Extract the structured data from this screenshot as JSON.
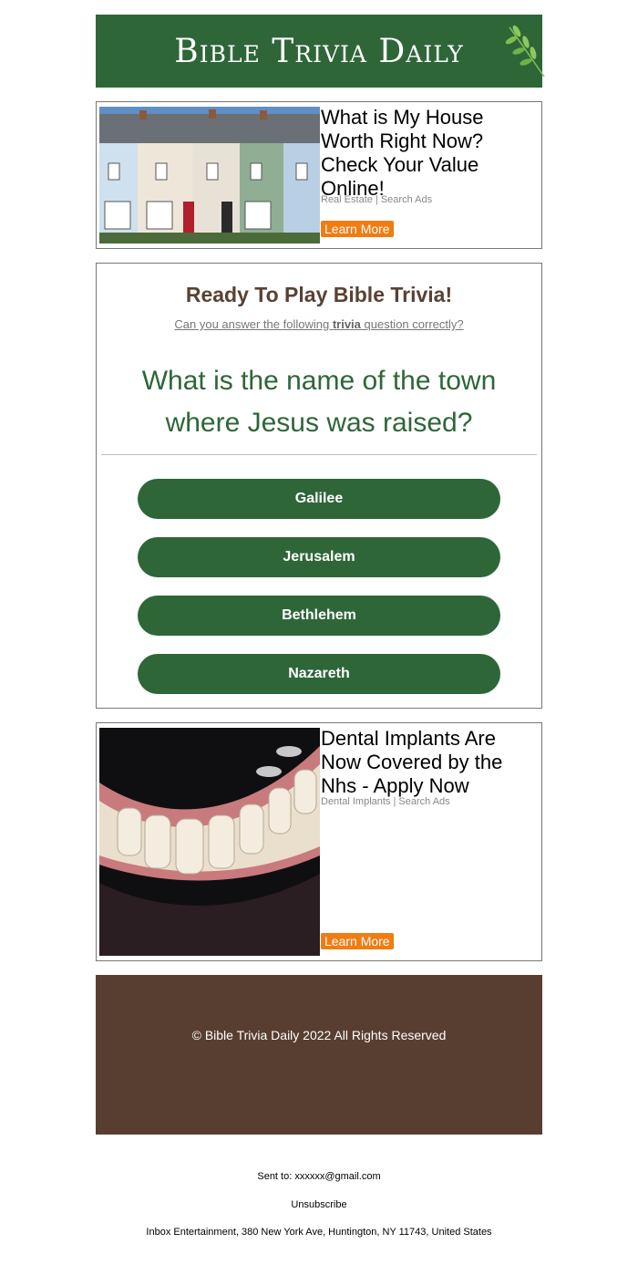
{
  "header": {
    "logo_text": "Bible Trivia Daily"
  },
  "ad_top": {
    "title": "What is My House Worth Right Now? Check Your Value Online!",
    "meta": "Real Estate | Search Ads",
    "cta": "Learn More",
    "image_alt": "row-of-houses"
  },
  "quiz": {
    "heading": "Ready To Play Bible Trivia!",
    "sub_before": "Can you answer the following ",
    "sub_bold": "trivia",
    "sub_after": " question correctly?",
    "question": "What is the name of the town where Jesus was raised?",
    "answers": [
      "Galilee",
      "Jerusalem",
      "Bethlehem",
      "Nazareth"
    ]
  },
  "ad_bottom": {
    "title": "Dental Implants Are Now Covered by the Nhs - Apply Now",
    "meta": "Dental Implants | Search Ads",
    "cta": "Learn More",
    "image_alt": "denture-with-implants"
  },
  "footer": {
    "copyright": "© Bible Trivia Daily 2022 All Rights Reserved"
  },
  "email_footer": {
    "sent_to": "Sent to: xxxxxx@gmail.com",
    "unsubscribe": "Unsubscribe",
    "address": "Inbox Entertainment, 380 New York Ave, Huntington, NY 11743, United States"
  },
  "colors": {
    "brand_green": "#2e6638",
    "footer_brown": "#583e30",
    "cta_orange": "#f07c12"
  }
}
